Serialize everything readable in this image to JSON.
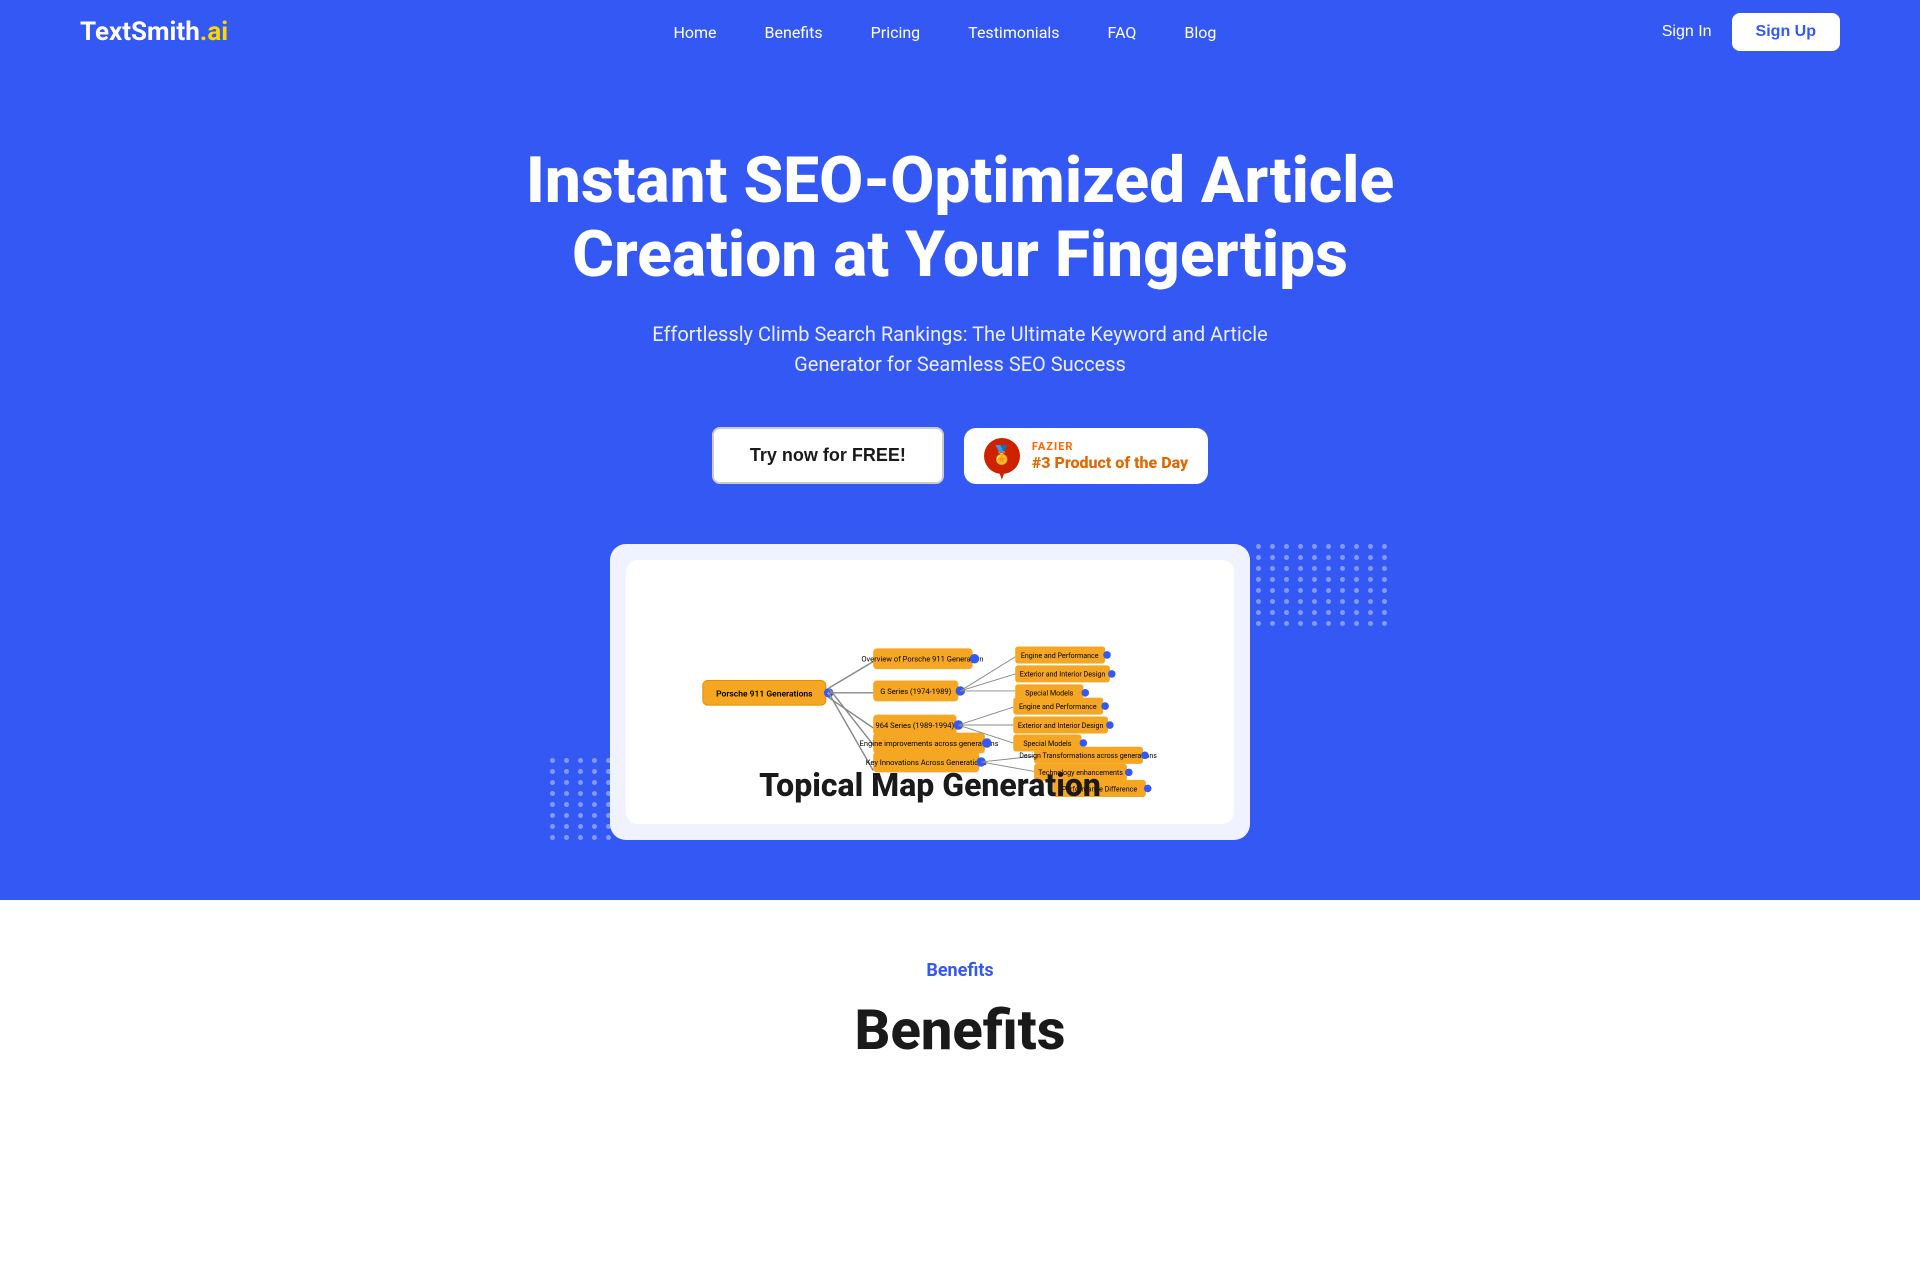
{
  "brand": {
    "name_main": "TextSmith",
    "name_suffix": ".ai"
  },
  "nav": {
    "links": [
      {
        "label": "Home",
        "id": "home"
      },
      {
        "label": "Benefits",
        "id": "benefits"
      },
      {
        "label": "Pricing",
        "id": "pricing"
      },
      {
        "label": "Testimonials",
        "id": "testimonials"
      },
      {
        "label": "FAQ",
        "id": "faq"
      },
      {
        "label": "Blog",
        "id": "blog"
      }
    ],
    "sign_in": "Sign In",
    "sign_up": "Sign Up"
  },
  "hero": {
    "title": "Instant SEO-Optimized Article Creation at Your Fingertips",
    "subtitle": "Effortlessly Climb Search Rankings: The Ultimate Keyword and Article Generator for Seamless SEO Success",
    "cta_primary": "Try now for FREE!",
    "badge_label": "FAZIER",
    "badge_rank": "#3 Product of the Day"
  },
  "feature_card": {
    "title": "Topical Map Generation"
  },
  "benefits_section": {
    "section_label": "Benefits",
    "section_title": "Benefits"
  },
  "colors": {
    "brand_blue": "#3358f4",
    "white": "#ffffff",
    "gold": "#ffd700",
    "orange": "#e06600"
  }
}
